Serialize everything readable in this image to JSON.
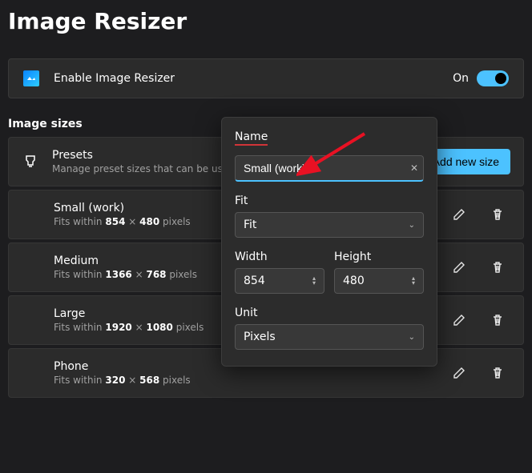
{
  "pageTitle": "Image Resizer",
  "enablePanel": {
    "label": "Enable Image Resizer",
    "stateText": "On"
  },
  "sectionLabel": "Image sizes",
  "presets": {
    "title": "Presets",
    "subtitle": "Manage preset sizes that can be used i",
    "addButton": "Add new size"
  },
  "sizes": [
    {
      "name": "Small (work)",
      "prefix": "Fits within",
      "w": "854",
      "h": "480",
      "unit": "pixels"
    },
    {
      "name": "Medium",
      "prefix": "Fits within",
      "w": "1366",
      "h": "768",
      "unit": "pixels"
    },
    {
      "name": "Large",
      "prefix": "Fits within",
      "w": "1920",
      "h": "1080",
      "unit": "pixels"
    },
    {
      "name": "Phone",
      "prefix": "Fits within",
      "w": "320",
      "h": "568",
      "unit": "pixels"
    }
  ],
  "dialog": {
    "nameLabel": "Name",
    "nameValue": "Small (work)",
    "fitLabel": "Fit",
    "fitValue": "Fit",
    "widthLabel": "Width",
    "widthValue": "854",
    "heightLabel": "Height",
    "heightValue": "480",
    "unitLabel": "Unit",
    "unitValue": "Pixels"
  }
}
